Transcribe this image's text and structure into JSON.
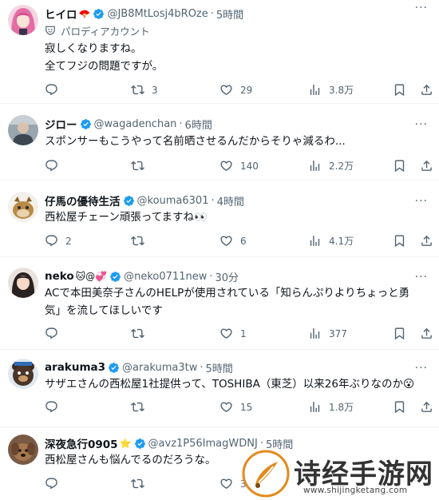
{
  "tweets": [
    {
      "name": "ヒイロ",
      "name_emoji": "🪭",
      "handle": "@JB8MtLosj4bROze",
      "time": "5時間",
      "parody": "パロディアカウント",
      "text": [
        "寂しくなりますね。",
        "全てフジの問題ですが。"
      ],
      "replies": "",
      "retweets": "3",
      "likes": "29",
      "views": "3.8万",
      "avatar_icon": "anime-girl-pink-hair-avatar"
    },
    {
      "name": "ジロー",
      "name_emoji": "",
      "handle": "@wagadenchan",
      "time": "6時間",
      "text": [
        "スポンサーもこうやって名前晒させるんだからそりゃ減るわ..."
      ],
      "replies": "",
      "retweets": "",
      "likes": "140",
      "views": "2.2万",
      "avatar_icon": "person-photo-avatar"
    },
    {
      "name": "仔馬の優待生活",
      "name_emoji": "",
      "handle": "@kouma6301",
      "time": "4時間",
      "text": [
        "西松屋チェーン頑張ってますね👀"
      ],
      "replies": "2",
      "retweets": "",
      "likes": "6",
      "views": "4.1万",
      "avatar_icon": "pony-avatar"
    },
    {
      "name": "neko",
      "name_emoji": "🐱@💞",
      "handle": "@neko0711new",
      "time": "30分",
      "text": [
        "ACで本田美奈子さんのHELPが使用されている「知らんぷりよりちょっと勇",
        "気」を流してほしいです"
      ],
      "replies": "",
      "retweets": "",
      "likes": "1",
      "views": "377",
      "avatar_icon": "woman-photo-avatar"
    },
    {
      "name": "arakuma3",
      "name_emoji": "",
      "handle": "@arakuma3tw",
      "time": "5時間",
      "text": [
        "サザエさんの西松屋1社提供って、TOSHIBA（東芝）以来26年ぶりなのか😮"
      ],
      "replies": "",
      "retweets": "",
      "likes": "15",
      "views": "1.8万",
      "avatar_icon": "bear-mascot-avatar"
    },
    {
      "name": "深夜急行0905",
      "name_emoji": "⭐",
      "handle": "@avz1P56ImagWDNJ",
      "time": "5時間",
      "text": [
        "西松屋さんも悩んでるのだろうな。"
      ],
      "replies": "",
      "retweets": "",
      "likes": "3",
      "views": "",
      "avatar_icon": "dog-photo-avatar"
    }
  ],
  "watermark": {
    "title": "诗经手游网",
    "url": "www.shijingketang.com"
  },
  "colors": {
    "text": "#0f1419",
    "muted": "#536471",
    "verified": "#1d9bf0",
    "divider": "#eff3f4"
  }
}
